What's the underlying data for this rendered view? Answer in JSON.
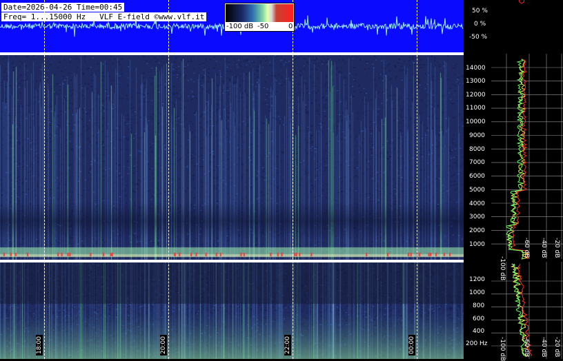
{
  "header": {
    "date_line": "Date=2026-04-26 Time=00:45",
    "freq_line": "Freq= 1...15000 Hz   VLF E-field ©www.vlf.it"
  },
  "colorbar": {
    "labels": [
      "-100 dB",
      "-50",
      "0"
    ]
  },
  "waveform_scale": [
    "50 %",
    "0 %",
    "-50 %"
  ],
  "freq_axis_main": [
    "14000",
    "13000",
    "12000",
    "11000",
    "10000",
    "9000",
    "8000",
    "7000",
    "6000",
    "5000",
    "4000",
    "3000",
    "2000",
    "1000"
  ],
  "freq_axis_low": [
    "1200",
    "1000",
    "800",
    "600",
    "400",
    "200 Hz"
  ],
  "db_axis": [
    "-100 dB",
    "-60 dB",
    "-40 dB",
    "-20 dB"
  ],
  "time_labels": [
    "18:00",
    "20:00",
    "22:00",
    "00:00"
  ],
  "colors": {
    "waveform_bg": "#0a0aff",
    "waveform_trace": "#9ff0ff",
    "spectrum_bg": "#20306a",
    "accent_red": "#ff2020",
    "accent_yellow": "#f0f060"
  }
}
